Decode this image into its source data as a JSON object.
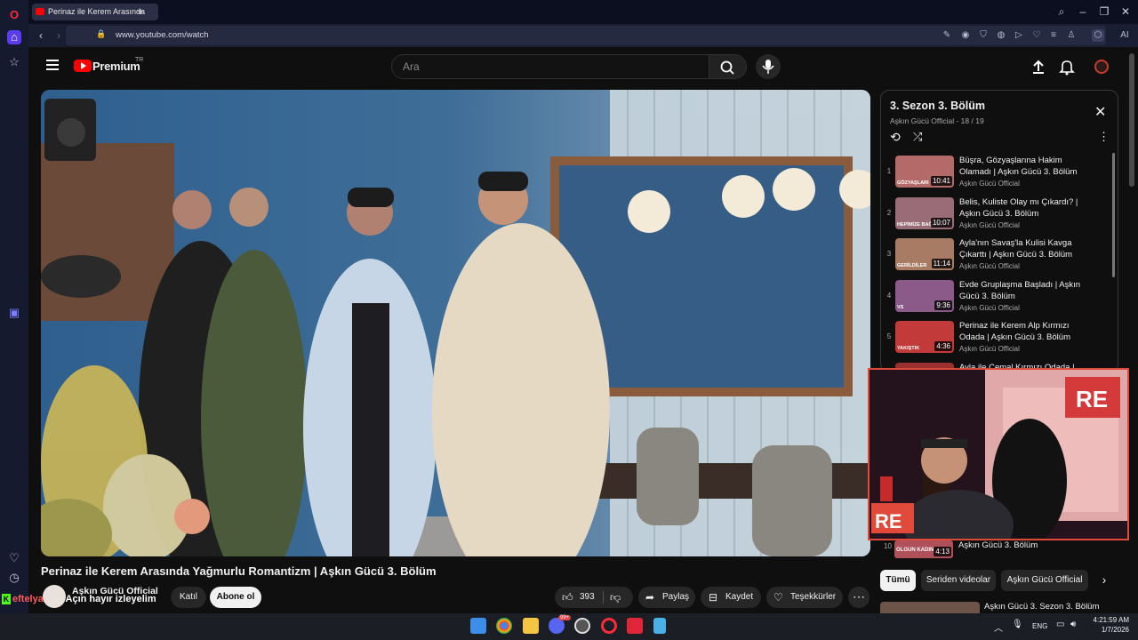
{
  "browser": {
    "tab_title": "Perinaz ile Kerem Arasında",
    "url": "www.youtube.com/watch"
  },
  "header": {
    "logo_text": "Premium",
    "logo_badge": "TR",
    "search_placeholder": "Ara"
  },
  "video": {
    "title": "Perinaz ile Kerem Arasında Yağmurlu Romantizm | Aşkın Gücü 3. Bölüm",
    "channel": "Aşkın Gücü Official",
    "join_label": "Katıl",
    "subscribe_label": "Abone ol",
    "likes": "393",
    "share_label": "Paylaş",
    "save_label": "Kaydet",
    "thanks_label": "Teşekkürler"
  },
  "chat_overlay": {
    "user": "eftelyaliss",
    "message": ": Açın hayır izleyelim"
  },
  "playlist": {
    "title": "3. Sezon 3. Bölüm",
    "subtitle": "Aşkın Gücü Official - 18 / 19",
    "items": [
      {
        "num": "1",
        "title": "Büşra, Gözyaşlarına Hakim Olamadı | Aşkın Gücü 3. Bölüm",
        "channel": "Aşkın Gücü Official",
        "duration": "10:41",
        "thumb_text": "GÖZYAŞLARI",
        "color": "#b56a6a"
      },
      {
        "num": "2",
        "title": "Belis, Kuliste Olay mı Çıkardı? | Aşkın Gücü 3. Bölüm",
        "channel": "Aşkın Gücü Official",
        "duration": "10:07",
        "thumb_text": "HEPİMİZE BAĞIRDI",
        "color": "#9a6c78"
      },
      {
        "num": "3",
        "title": "Ayla'nın Savaş'la Kulisi Kavga Çıkarttı | Aşkın Gücü 3. Bölüm",
        "channel": "Aşkın Gücü Official",
        "duration": "11:14",
        "thumb_text": "GERİLDİLER",
        "color": "#a87b64"
      },
      {
        "num": "4",
        "title": "Evde Gruplaşma Başladı | Aşkın Gücü 3. Bölüm",
        "channel": "Aşkın Gücü Official",
        "duration": "9:36",
        "thumb_text": "VS",
        "color": "#8c5a88"
      },
      {
        "num": "5",
        "title": "Perinaz ile Kerem Alp Kırmızı Odada | Aşkın Gücü 3. Bölüm",
        "channel": "Aşkın Gücü Official",
        "duration": "4:36",
        "thumb_text": "YAKIŞTIK",
        "color": "#c23a3a"
      },
      {
        "num": "6",
        "title": "Ayla ile Cemal Kırmızı Odada | Aşkın Gücü 3. Bölüm",
        "channel": "Aşkın Gücü Official",
        "duration": "",
        "thumb_text": "",
        "color": "#9b3030"
      }
    ],
    "item_10": {
      "num": "10",
      "title": "Aşkın Gücü 3. Bölüm",
      "duration": "4:13",
      "thumb_text": "OLGUN KADIN"
    }
  },
  "filters": {
    "chips": [
      "Tümü",
      "Seriden videolar",
      "Aşkın Gücü Official"
    ]
  },
  "recommended": {
    "title": "Aşkın Gücü 3. Sezon 3. Bölüm"
  },
  "taskbar": {
    "lang": "ENG",
    "time": "4:21:59 AM",
    "date": "1/7/2026",
    "badge": "99+"
  },
  "colors": {
    "yt_red": "#ff0000",
    "accent_opera": "#e0202a",
    "chip_active_bg": "#f1f1f1"
  }
}
